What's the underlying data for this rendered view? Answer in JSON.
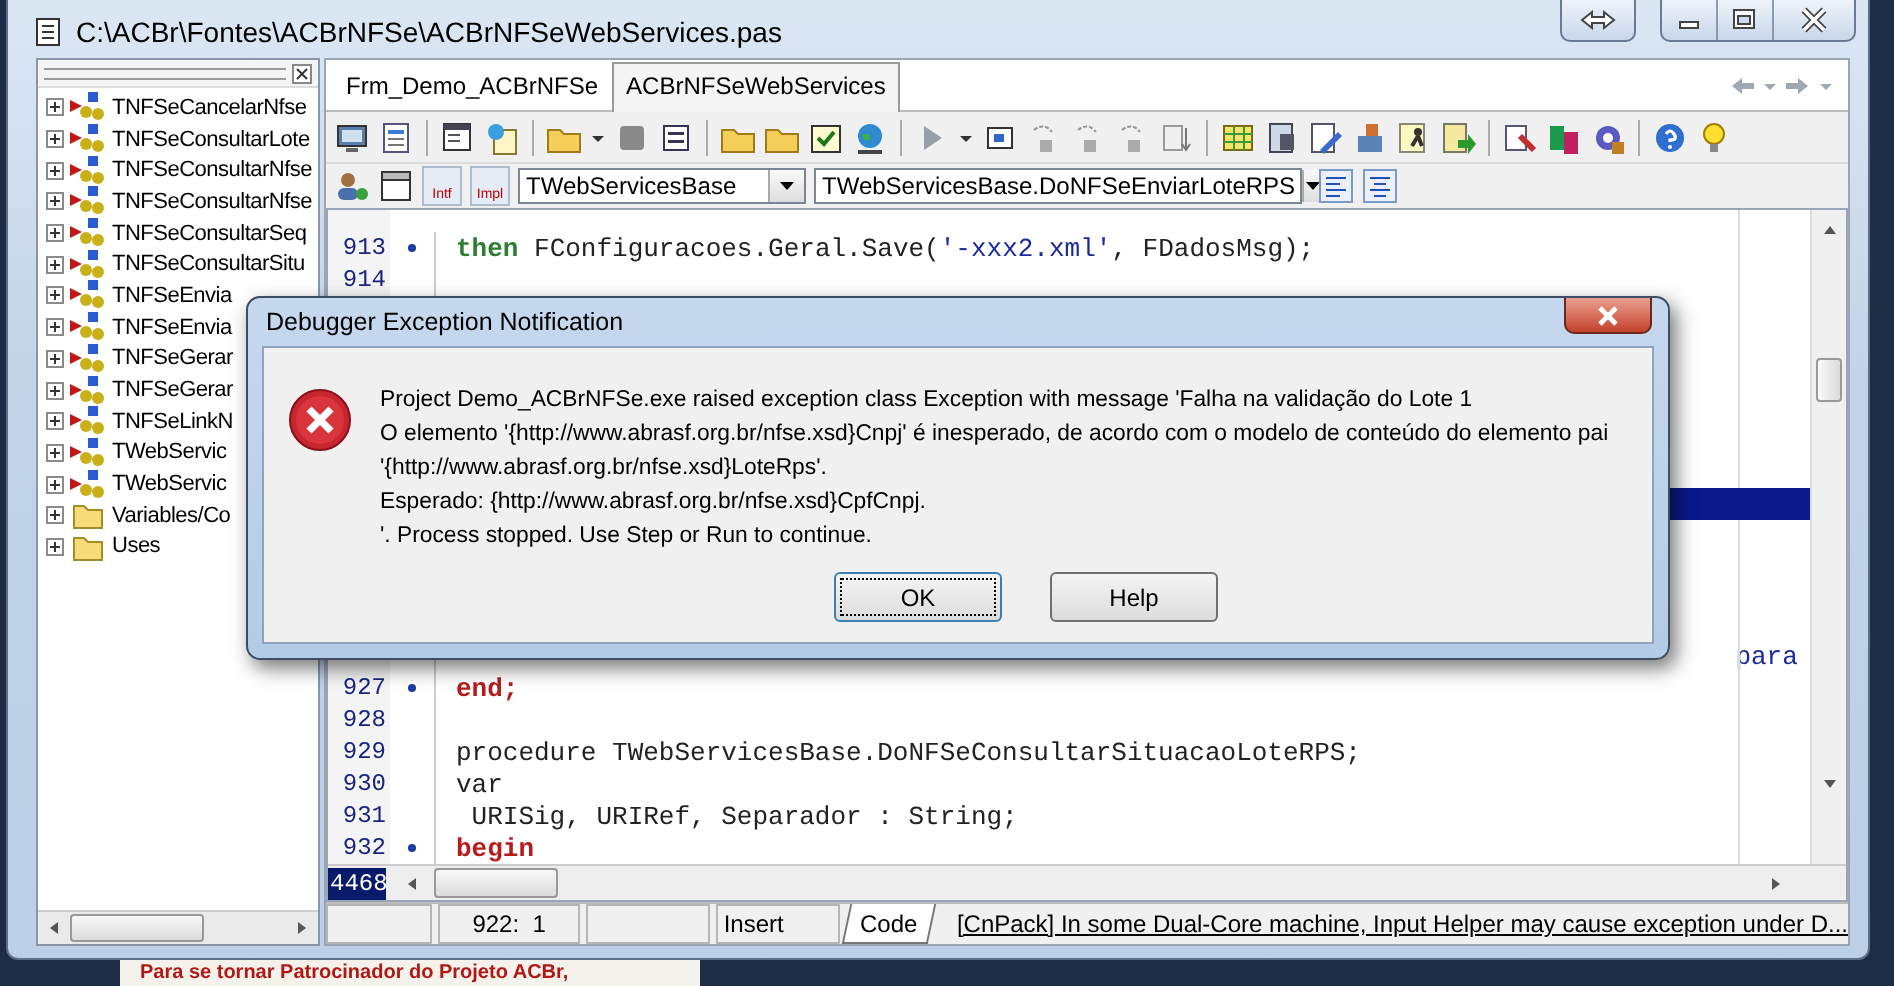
{
  "window": {
    "title": "C:\\ACBr\\Fontes\\ACBrNFSe\\ACBrNFSeWebServices.pas"
  },
  "structure_tree": {
    "items": [
      {
        "label": "TNFSeCancelarNfse",
        "kind": "class",
        "expanded": false
      },
      {
        "label": "TNFSeConsultarLote",
        "kind": "class",
        "expanded": false
      },
      {
        "label": "TNFSeConsultarNfse",
        "kind": "class",
        "expanded": false
      },
      {
        "label": "TNFSeConsultarNfse",
        "kind": "class",
        "expanded": false
      },
      {
        "label": "TNFSeConsultarSeq",
        "kind": "class",
        "expanded": false
      },
      {
        "label": "TNFSeConsultarSitu",
        "kind": "class",
        "expanded": false
      },
      {
        "label": "TNFSeEnvia",
        "kind": "class",
        "expanded": false
      },
      {
        "label": "TNFSeEnvia",
        "kind": "class",
        "expanded": false
      },
      {
        "label": "TNFSeGerar",
        "kind": "class",
        "expanded": false
      },
      {
        "label": "TNFSeGerar",
        "kind": "class",
        "expanded": false
      },
      {
        "label": "TNFSeLinkN",
        "kind": "class",
        "expanded": false
      },
      {
        "label": "TWebServic",
        "kind": "class",
        "expanded": false
      },
      {
        "label": "TWebServic",
        "kind": "class",
        "expanded": false
      },
      {
        "label": "Variables/Co",
        "kind": "folder",
        "expanded": false
      },
      {
        "label": "Uses",
        "kind": "folder",
        "expanded": false
      }
    ]
  },
  "editor_tabs": [
    {
      "label": "Frm_Demo_ACBrNFSe",
      "selected": false
    },
    {
      "label": "ACBrNFSeWebServices",
      "selected": true
    }
  ],
  "interface_button": {
    "label": "Intf"
  },
  "implementation_button": {
    "label": "Impl"
  },
  "class_combo": {
    "value": "TWebServicesBase"
  },
  "method_combo": {
    "value": "TWebServicesBase.DoNFSeEnviarLoteRPS"
  },
  "code_lines_top": [
    {
      "number": "913",
      "marked": true,
      "segments": [
        {
          "kind": "keyword",
          "color": "#2e7d32",
          "text": "then"
        },
        {
          "kind": "plain",
          "text": " FConfiguracoes.Geral.Save("
        },
        {
          "kind": "string",
          "text": "'-xxx2.xml'"
        },
        {
          "kind": "plain",
          "text": ", FDadosMsg);"
        }
      ]
    },
    {
      "number": "914",
      "marked": false
    }
  ],
  "execution_point": true,
  "covered_line_tail": {
    "kind": "string",
    "text": "para"
  },
  "code_lines_bottom": [
    {
      "number": "927",
      "marked": true,
      "segments": [
        {
          "kind": "keyword",
          "color": "#b71c1c",
          "text": "end;"
        }
      ]
    },
    {
      "number": "928",
      "marked": false
    },
    {
      "number": "929",
      "marked": false,
      "segments": [
        {
          "kind": "plain",
          "text": "procedure TWebServicesBase.DoNFSeConsultarSituacaoLoteRPS;"
        }
      ]
    },
    {
      "number": "930",
      "marked": false,
      "segments": [
        {
          "kind": "plain",
          "text": "var"
        }
      ]
    },
    {
      "number": "931",
      "marked": false,
      "segments": [
        {
          "kind": "plain",
          "text": " URISig, URIRef, Separador : String;"
        }
      ]
    },
    {
      "number": "932",
      "marked": true,
      "segments": [
        {
          "kind": "keyword",
          "color": "#b71c1c",
          "text": "begin"
        }
      ]
    }
  ],
  "line_count": "4468",
  "status_bar": {
    "cursor": "922:  1",
    "mode": "Insert",
    "view_tab": "Code",
    "message": "[CnPack] In some Dual-Core machine, Input Helper may cause exception under D..."
  },
  "dialog": {
    "title": "Debugger Exception Notification",
    "message_lines": [
      "Project Demo_ACBrNFSe.exe raised exception class Exception with message 'Falha na validação do Lote 1",
      "O elemento '{http://www.abrasf.org.br/nfse.xsd}Cnpj' é inesperado, de acordo com o modelo de conteúdo do elemento pai",
      "'{http://www.abrasf.org.br/nfse.xsd}LoteRps'.",
      "Esperado: {http://www.abrasf.org.br/nfse.xsd}CpfCnpj.",
      "'. Process stopped. Use Step or Run to continue."
    ],
    "buttons": [
      {
        "label": "OK",
        "focused": true
      },
      {
        "label": "Help",
        "focused": false
      }
    ]
  },
  "background_text": "Para se tornar Patrocinador do Projeto ACBr,"
}
